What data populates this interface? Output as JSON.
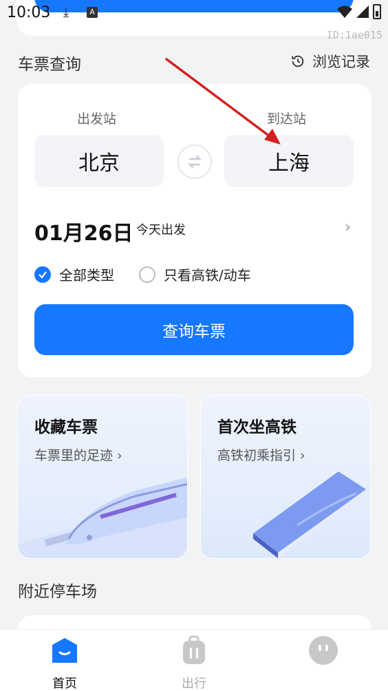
{
  "status_bar": {
    "time": "10:03",
    "download_icon": "download-icon",
    "a_icon_label": "A",
    "watermark": "ID:1ae015"
  },
  "section": {
    "title": "车票查询",
    "history_label": "浏览记录"
  },
  "ticket": {
    "from_label": "出发站",
    "to_label": "到达站",
    "from_station": "北京",
    "to_station": "上海",
    "date": "01月26日",
    "date_sub": "今天出发",
    "date_arrow": "›",
    "type_all": "全部类型",
    "type_highspeed": "只看高铁/动车",
    "search_label": "查询车票",
    "accent": "#1677ff"
  },
  "promos": [
    {
      "title": "收藏车票",
      "subtitle": "车票里的足迹 ›"
    },
    {
      "title": "首次坐高铁",
      "subtitle": "高铁初乘指引 ›"
    }
  ],
  "nearby": {
    "title": "附近停车场"
  },
  "nav": [
    {
      "label": "首页",
      "icon": "home-icon",
      "active": true
    },
    {
      "label": "出行",
      "icon": "luggage-icon",
      "active": false
    },
    {
      "label": "",
      "icon": "face-icon",
      "active": false
    }
  ],
  "annotation": {
    "color": "#d32020"
  }
}
